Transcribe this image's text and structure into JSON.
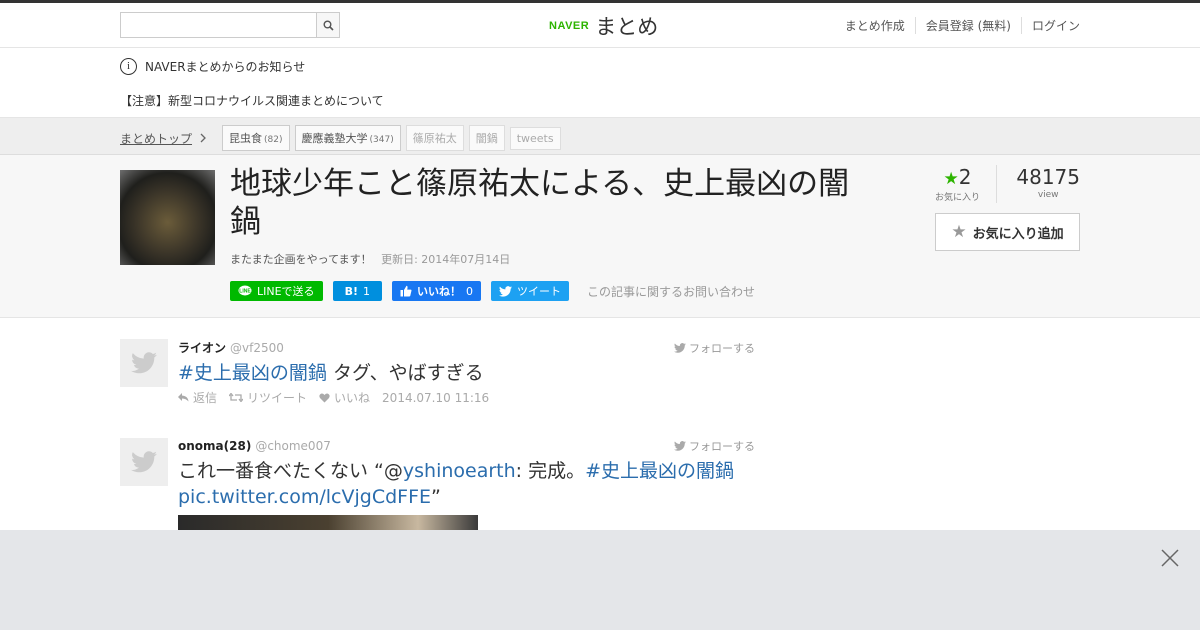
{
  "header": {
    "search_placeholder": "",
    "logo_brand": "NAVER",
    "logo_text": "まとめ",
    "nav": [
      "まとめ作成",
      "会員登録 (無料)",
      "ログイン"
    ]
  },
  "notice": {
    "heading": "NAVERまとめからのお知らせ",
    "message": "【注意】新型コロナウイルス関連まとめについて"
  },
  "breadcrumb": {
    "top": "まとめトップ",
    "tags": [
      {
        "label": "昆虫食",
        "count": "(82)"
      },
      {
        "label": "慶應義塾大学",
        "count": "(347)"
      },
      {
        "label": "篠原祐太",
        "count": ""
      },
      {
        "label": "闇鍋",
        "count": ""
      },
      {
        "label": "tweets",
        "count": ""
      }
    ]
  },
  "article": {
    "title": "地球少年こと篠原祐太による、史上最凶の闇鍋",
    "description": "またまた企画をやってます！",
    "updated": "更新日: 2014年07月14日",
    "favorites_count": "2",
    "favorites_label": "お気に入り",
    "views_count": "48175",
    "views_label": "view",
    "fav_button": "お気に入り追加"
  },
  "social": {
    "line": "LINEで送る",
    "hatena_icon": "B!",
    "hatena_count": "1",
    "fb_label": "いいね！",
    "fb_count": "0",
    "tweet": "ツイート",
    "inquiry": "この記事に関するお問い合わせ"
  },
  "tweets": [
    {
      "name": "ライオン",
      "handle": "@vf2500",
      "follow": "フォローする",
      "hashtag": "#史上最凶の闇鍋",
      "text_after": " タグ、やばすぎる",
      "reply": "返信",
      "retweet": "リツイート",
      "like": "いいね",
      "time": "2014.07.10 11:16"
    },
    {
      "name": "onoma(28)",
      "handle": "@chome007",
      "follow": "フォローする",
      "text_before": "これ一番食べたくない “@",
      "mention": "yshinoearth",
      "text_mid": ": 完成。",
      "hashtag": "#史上最凶の闇鍋",
      "link": "pic.twitter.com/lcVjgCdFFE",
      "text_end": "”"
    }
  ],
  "colors": {
    "naver_green": "#2db400",
    "link_blue": "#2b6dad",
    "line_green": "#00b900",
    "hatena_blue": "#008fde",
    "fb_blue": "#1877f2",
    "twitter_blue": "#1da1f2"
  }
}
